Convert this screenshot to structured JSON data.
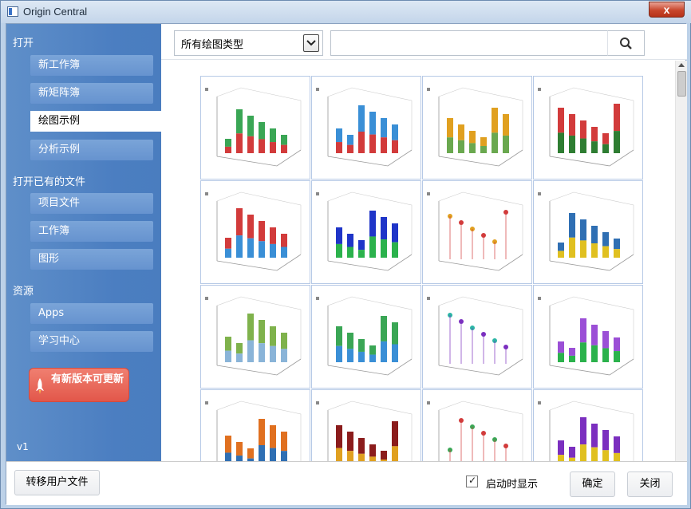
{
  "window": {
    "title": "Origin Central",
    "close_glyph": "x"
  },
  "sidebar": {
    "sections": [
      {
        "heading": "打开",
        "items": [
          "新工作簿",
          "新矩阵簿",
          "绘图示例",
          "分析示例"
        ]
      },
      {
        "heading": "打开已有的文件",
        "items": [
          "项目文件",
          "工作簿",
          "图形"
        ]
      },
      {
        "heading": "资源",
        "items": [
          "Apps",
          "学习中心"
        ]
      }
    ],
    "selected_item": "绘图示例",
    "update_button": "有新版本可更新",
    "version": "v1"
  },
  "filter": {
    "plot_type_selected": "所有绘图类型",
    "search_value": "",
    "search_icon": "search-icon"
  },
  "gallery": {
    "thumbnails": [
      {
        "name": "3d-stacked-bars"
      },
      {
        "name": "grouped-bar-chart"
      },
      {
        "name": "sales-report-3d-bars"
      },
      {
        "name": "3d-bars-colormap"
      },
      {
        "name": "3d-bars-colorscale"
      },
      {
        "name": "3d-bars-blue-green"
      },
      {
        "name": "3d-scatter-drop-lines"
      },
      {
        "name": "3d-stacked-cylinders"
      },
      {
        "name": "3d-area-wall"
      },
      {
        "name": "3d-scatter-ellipsoids"
      },
      {
        "name": "3d-ribbon-waterfall"
      },
      {
        "name": "3d-scatter-purple"
      },
      {
        "name": "3d-scatter-colorscale"
      },
      {
        "name": "3d-stacked-area"
      },
      {
        "name": "3d-sine-waves"
      },
      {
        "name": "3d-surface-colormap"
      }
    ]
  },
  "bottom": {
    "transfer_button": "转移用户文件",
    "startup_checkbox_label": "启动时显示",
    "startup_checked": true,
    "ok_button": "确定",
    "close_button": "关闭"
  },
  "colors": {
    "sidebar_bg": "#4b7ec1",
    "nav_item_bg": "#6d99d3",
    "update_button": "#e65b4d",
    "thumb_border": "#b6c9e6"
  }
}
